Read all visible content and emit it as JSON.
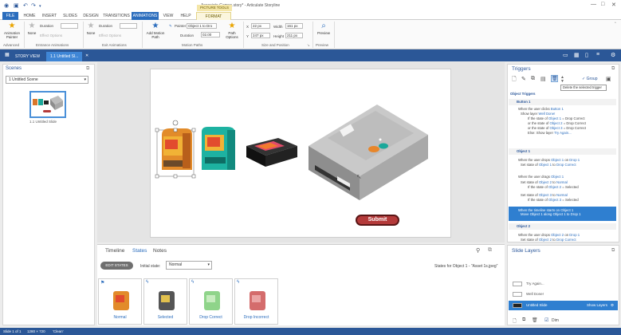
{
  "title_bar": {
    "doc_title": "Associate Games.story* - Articulate Storyline",
    "contextual_tab_group": "PICTURE TOOLS"
  },
  "ribbon_tabs": [
    "FILE",
    "HOME",
    "INSERT",
    "SLIDES",
    "DESIGN",
    "TRANSITIONS",
    "ANIMATIONS",
    "VIEW",
    "HELP",
    "FORMAT"
  ],
  "active_tab": "ANIMATIONS",
  "ribbon": {
    "animation_painter": "Animation Painter",
    "advanced_label": "Advanced",
    "entrance_none": "None",
    "entrance_duration_label": "Duration",
    "entrance_effect_options": "Effect Options",
    "entrance_group": "Entrance Animations",
    "exit_none": "None",
    "exit_duration_label": "Duration",
    "exit_effect_options": "Effect Options",
    "exit_group": "Exit Animations",
    "add_motion_path": "Add Motion Path",
    "painter": "Painter",
    "object_dropdown": "Object 1 to Dro",
    "motion_duration_label": "Duration",
    "motion_duration_value": "02.00",
    "path_options": "Path Options",
    "motion_group": "Motion Paths",
    "x_label": "X",
    "x_value": "22 px",
    "y_label": "Y",
    "y_value": "247 px",
    "width_label": "Width",
    "width_value": "161 px",
    "height_label": "Height",
    "height_value": "211 px",
    "size_group": "Size and Position",
    "preview_label": "Preview",
    "preview_group": "Preview"
  },
  "doc_tabs": {
    "story_view": "STORY VIEW",
    "slide_tab": "1.1 Untitled Sl..."
  },
  "scenes_panel": {
    "title": "Scenes",
    "scene_select": "1 Untitled Scene",
    "slide_label": "1.1 Untitled Slide"
  },
  "stage": {
    "submit_label": "Submit"
  },
  "bottom_panel": {
    "tabs": [
      "Timeline",
      "States",
      "Notes"
    ],
    "active_tab": "States",
    "edit_states": "EDIT STATES",
    "initial_state_label": "Initial state:",
    "initial_state_value": "Normal",
    "states_for": "States for Object 1 - \"Asset 1s.jpeg\"",
    "states": [
      "Normal",
      "Selected",
      "Drop Correct",
      "Drop Incorrect"
    ]
  },
  "triggers_panel": {
    "title": "Triggers",
    "group_label": "Group",
    "tooltip": "Delete the selected trigger",
    "object_triggers": "Object Triggers",
    "button1": "Button 1",
    "t1a": "When the user clicks",
    "t1b": "Button 1",
    "t1c": "Show layer",
    "t1d": "Well Done!",
    "t1e": "If the state of",
    "t1f": "Object 1",
    "t1g": "= Drop Correct",
    "t1h": "or the state of",
    "t1i": "Object 2",
    "t1j": "= Drop Correct",
    "t1k": "or the state of",
    "t1l": "Object 3",
    "t1m": "= Drop Correct",
    "t1n": "Else: Show layer",
    "t1o": "Try Again...",
    "object1": "Object 1",
    "t2a": "When the user drops",
    "t2b": "Object 1",
    "t2c": "on",
    "t2d": "Drop 1",
    "t2e": "Set state of",
    "t2f": "Object 1",
    "t2g": "to",
    "t2h": "Drop Correct",
    "t3a": "When the user drags",
    "t3b": "Object 1",
    "t4a": "Set state of",
    "t4b": "Object 2",
    "t4c": "to",
    "t4d": "Normal",
    "t4e": "If the state of",
    "t4f": "Object 2",
    "t4g": "= Selected",
    "t5a": "Set state of",
    "t5b": "Object 3",
    "t5c": "to",
    "t5d": "Normal",
    "t5e": "If the state of",
    "t5f": "Object 3",
    "t5g": "= Selected",
    "t6a": "When the timeline starts on",
    "t6b": "Object 1",
    "t6c": "Move",
    "t6d": "Object 1",
    "t6e": "along",
    "t6f": "Object 1 to Drop 1",
    "object2": "Object 2",
    "t7a": "When the user drops",
    "t7b": "Object 2",
    "t7c": "on",
    "t7d": "Drop 1",
    "t7e": "Set state of",
    "t7f": "Object 2",
    "t7g": "to",
    "t7h": "Drop Correct"
  },
  "layers_panel": {
    "title": "Slide Layers",
    "layers": [
      "Try Again...",
      "Well Done!",
      "Untitled Slide"
    ],
    "show_layers": "Show Layers",
    "dim_label": "Dim"
  },
  "status_bar": {
    "slide": "Slide 1 of 1",
    "size": "1280 × 720",
    "theme": "'Clean'"
  },
  "colors": {
    "accent": "#2b6dbd",
    "doc_bar": "#2b5797",
    "submit": "#b43a3a",
    "highlight": "#2f7fd0"
  }
}
